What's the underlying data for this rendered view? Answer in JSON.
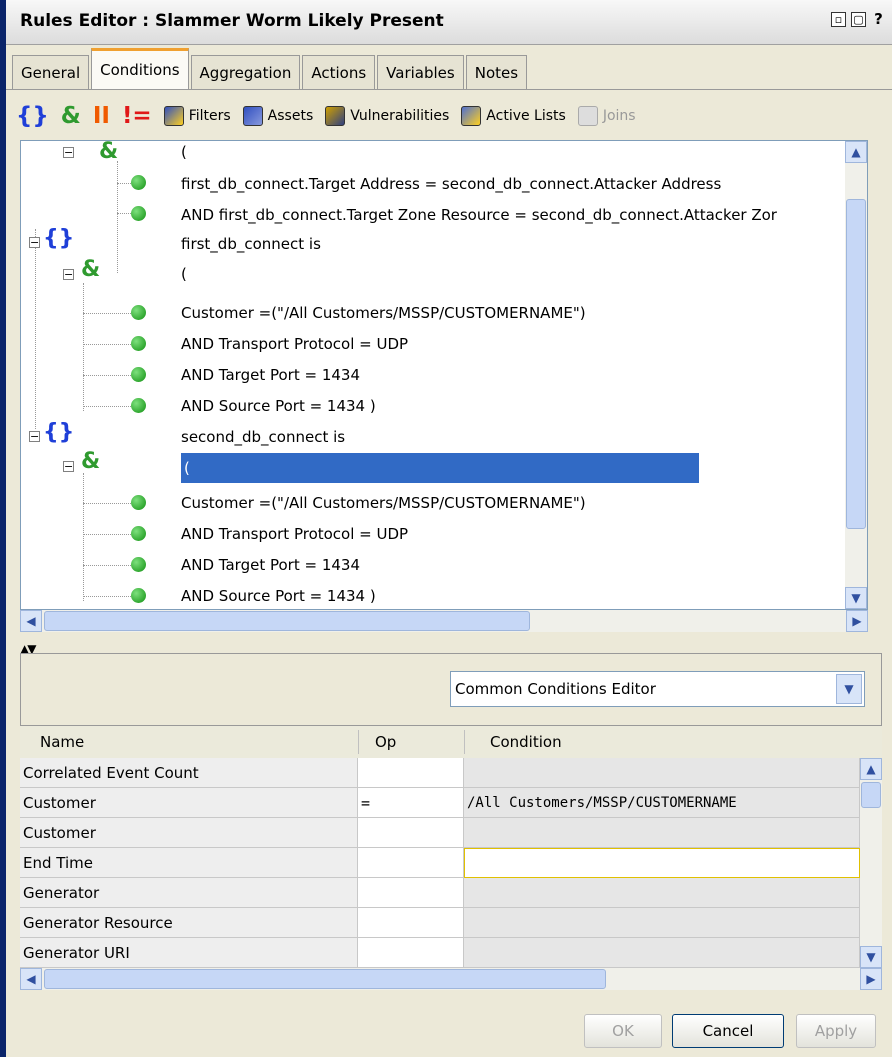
{
  "window": {
    "title": "Rules Editor : Slammer Worm Likely Present",
    "help": "?"
  },
  "tabs": [
    "General",
    "Conditions",
    "Aggregation",
    "Actions",
    "Variables",
    "Notes"
  ],
  "active_tab": "Conditions",
  "toolbar": {
    "or_group": "{}",
    "and_group": "&",
    "pause": "II",
    "not_equal": "!=",
    "filters": "Filters",
    "assets": "Assets",
    "vulnerabilities": "Vulnerabilities",
    "active_lists": "Active Lists",
    "joins": "Joins"
  },
  "tree": {
    "open_paren_1": "(",
    "cond_target_addr": "first_db_connect.Target Address = second_db_connect.Attacker Address",
    "cond_target_zone": "AND first_db_connect.Target Zone Resource = second_db_connect.Attacker Zor",
    "first_label": "first_db_connect is",
    "open_paren_2": "(",
    "first_customer": "Customer =(\"/All Customers/MSSP/CUSTOMERNAME\")",
    "first_transport": "AND Transport Protocol = UDP",
    "first_target_port": "AND Target Port = 1434",
    "first_source_port": "AND Source Port = 1434 )",
    "second_label": "second_db_connect is",
    "open_paren_3": "(",
    "second_customer": "Customer =(\"/All Customers/MSSP/CUSTOMERNAME\")",
    "second_transport": "AND Transport Protocol = UDP",
    "second_target_port": "AND Target Port = 1434",
    "second_source_port": "AND Source Port = 1434 )"
  },
  "editor_select": "Common Conditions Editor",
  "grid": {
    "headers": {
      "name": "Name",
      "op": "Op",
      "condition": "Condition"
    },
    "rows": [
      {
        "name": "Correlated Event Count",
        "op": "",
        "condition": ""
      },
      {
        "name": "Customer",
        "op": "=",
        "condition": "/All Customers/MSSP/CUSTOMERNAME"
      },
      {
        "name": "Customer",
        "op": "",
        "condition": ""
      },
      {
        "name": "End Time",
        "op": "",
        "condition": ""
      },
      {
        "name": "Generator",
        "op": "",
        "condition": ""
      },
      {
        "name": "Generator Resource",
        "op": "",
        "condition": ""
      },
      {
        "name": "Generator URI",
        "op": "",
        "condition": ""
      }
    ]
  },
  "buttons": {
    "ok": "OK",
    "cancel": "Cancel",
    "apply": "Apply"
  }
}
